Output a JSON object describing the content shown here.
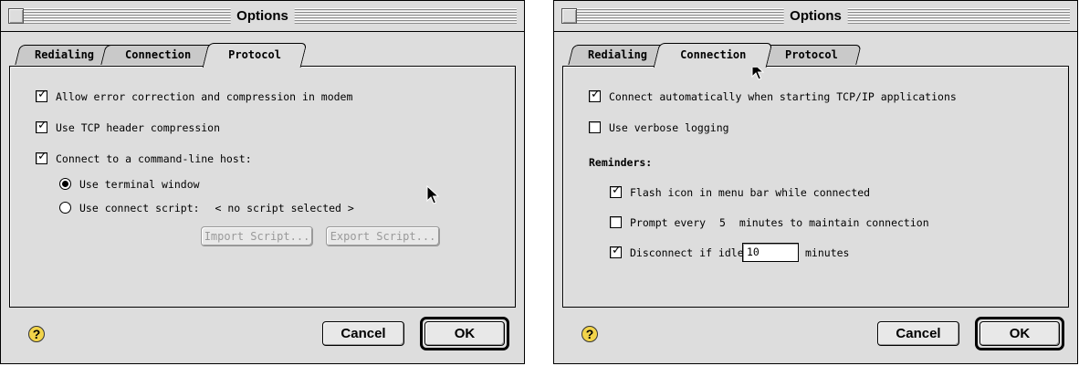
{
  "left_dialog": {
    "title": "Options",
    "tabs": [
      {
        "label": "Redialing",
        "active": false
      },
      {
        "label": "Connection",
        "active": false
      },
      {
        "label": "Protocol",
        "active": true
      }
    ],
    "options": {
      "error_correction": {
        "label": "Allow error correction and compression in modem",
        "checked": true
      },
      "tcp_header": {
        "label": "Use TCP header compression",
        "checked": true
      },
      "command_line_host": {
        "label": "Connect to a command-line host:",
        "checked": true
      },
      "terminal_window": {
        "label": "Use terminal window",
        "selected": true
      },
      "connect_script": {
        "label": "Use connect script:",
        "selected": false,
        "value": "< no script selected >"
      }
    },
    "buttons": {
      "import_script": "Import Script...",
      "export_script": "Export Script...",
      "cancel": "Cancel",
      "ok": "OK"
    },
    "help_icon": "?"
  },
  "right_dialog": {
    "title": "Options",
    "tabs": [
      {
        "label": "Redialing",
        "active": false
      },
      {
        "label": "Connection",
        "active": true
      },
      {
        "label": "Protocol",
        "active": false
      }
    ],
    "options": {
      "connect_auto": {
        "label": "Connect automatically when starting TCP/IP applications",
        "checked": true
      },
      "verbose_logging": {
        "label": "Use verbose logging",
        "checked": false
      }
    },
    "reminders": {
      "heading": "Reminders:",
      "flash_icon": {
        "label": "Flash icon in menu bar while connected",
        "checked": true
      },
      "prompt_every": {
        "label_before": "Prompt every",
        "value": "5",
        "label_after": "minutes to maintain connection",
        "checked": false
      },
      "disconnect_idle": {
        "label_before": "Disconnect if idle for",
        "value": "10",
        "label_after": "minutes",
        "checked": true
      }
    },
    "buttons": {
      "cancel": "Cancel",
      "ok": "OK"
    },
    "help_icon": "?"
  },
  "icons": {
    "checkmark": "✓",
    "cursor": "arrow-pointer"
  }
}
